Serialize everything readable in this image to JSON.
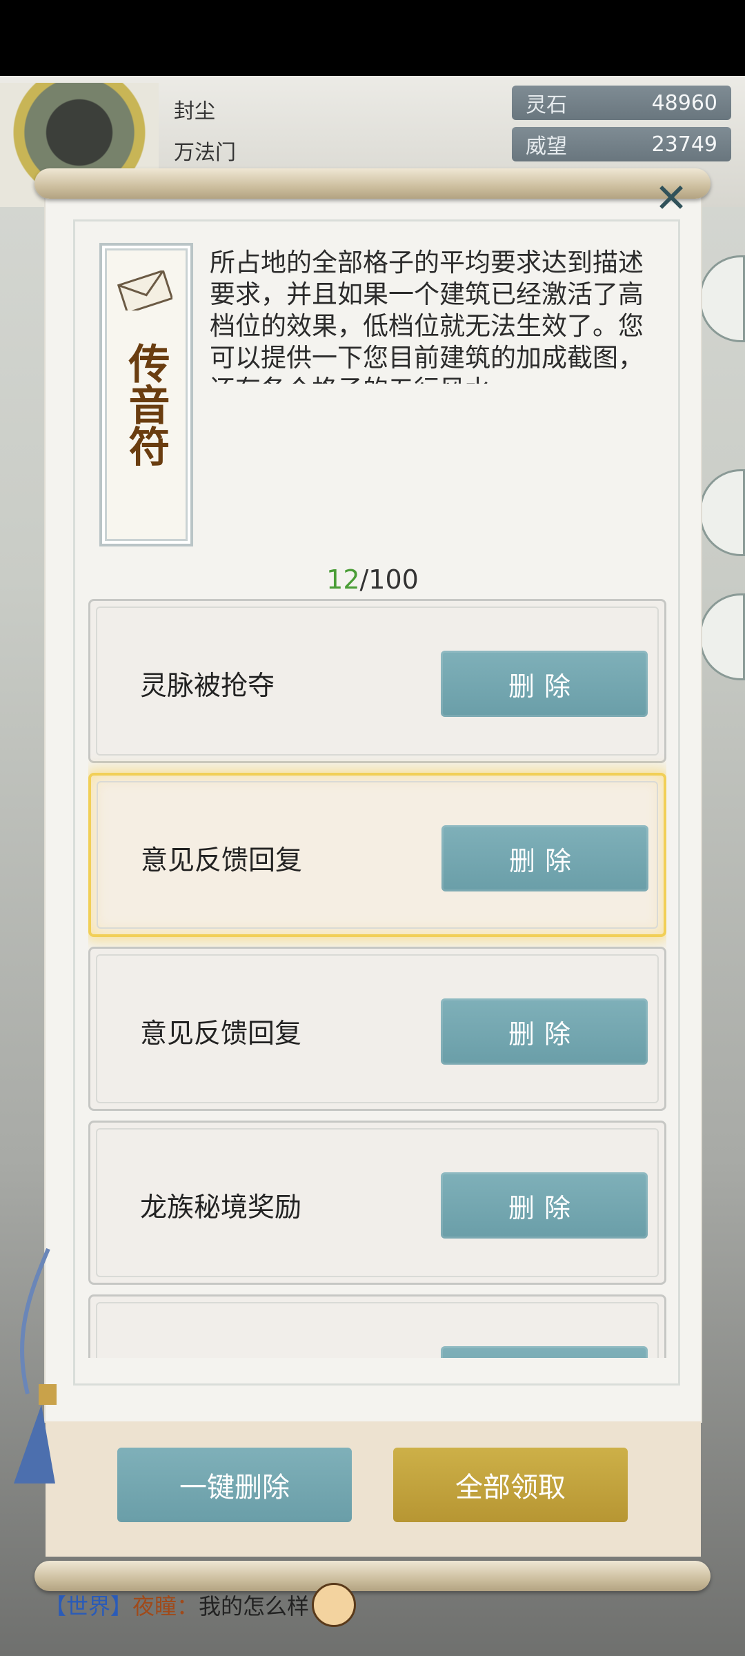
{
  "player": {
    "name": "封尘",
    "sect": "万法门",
    "resources": [
      {
        "label": "灵石",
        "value": "48960"
      },
      {
        "label": "威望",
        "value": "23749"
      }
    ]
  },
  "mail": {
    "tag_title": "传音符",
    "message": "所占地的全部格子的平均要求达到描述要求，并且如果一个建筑已经激活了高档位的效果，低档位就无法生效了。您可以提供一下您目前建筑的加成截图，还有各个格子的五行风水",
    "count_current": "12",
    "count_total": "/100",
    "items": [
      {
        "title": "灵脉被抢夺",
        "button": "删除"
      },
      {
        "title": "意见反馈回复",
        "button": "删除"
      },
      {
        "title": "意见反馈回复",
        "button": "删除"
      },
      {
        "title": "龙族秘境奖励",
        "button": "删除"
      },
      {
        "title": "",
        "button": ""
      }
    ],
    "delete_all_label": "一键删除",
    "claim_all_label": "全部领取"
  },
  "chat": {
    "channel": "【世界】",
    "sender": "夜瞳：",
    "text": "我的怎么样"
  },
  "icons": {
    "close": "close-icon",
    "envelope": "envelope-icon",
    "emoji": "emoji-icon"
  },
  "colors": {
    "button_teal": "#6a9ea8",
    "button_gold": "#b79633",
    "count_green": "#4a9d36",
    "selected_glow": "#f1cf57"
  }
}
